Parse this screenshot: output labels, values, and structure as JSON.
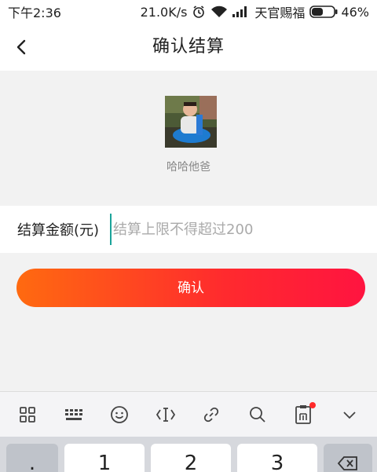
{
  "status_bar": {
    "time": "下午2:36",
    "speed": "21.0K/s",
    "carrier": "天官赐福",
    "battery": "46%"
  },
  "header": {
    "title": "确认结算",
    "back_icon": "back-arrow-icon"
  },
  "profile": {
    "username": "哈哈他爸"
  },
  "amount": {
    "label": "结算金额(元)",
    "placeholder": "结算上限不得超过200",
    "value": ""
  },
  "confirm_button": {
    "label": "确认"
  },
  "keyboard": {
    "toolbar_icons": [
      "grid-icon",
      "keyboard-icon",
      "emoji-icon",
      "cursor-icon",
      "link-icon",
      "search-icon",
      "clipboard-icon",
      "chevron-down-icon"
    ],
    "keys": [
      ".",
      "1",
      "2",
      "3",
      "backspace"
    ]
  },
  "colors": {
    "accent_start": "#ff6a10",
    "accent_end": "#ff1440",
    "cursor": "#1aa39a",
    "background": "#f2f2f2"
  }
}
